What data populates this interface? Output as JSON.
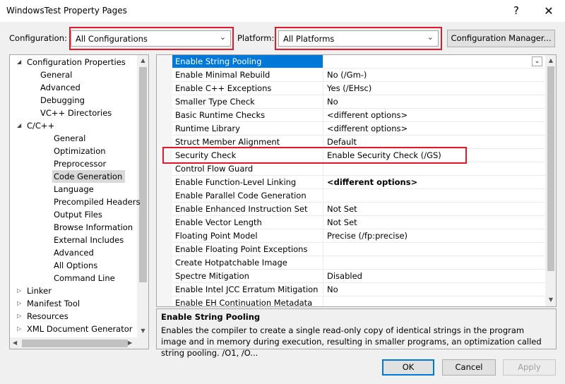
{
  "window": {
    "title": "WindowsTest Property Pages",
    "help_glyph": "?",
    "close_glyph": "✕"
  },
  "toolbar": {
    "configuration_label": "Configuration:",
    "configuration_value": "All Configurations",
    "platform_label": "Platform:",
    "platform_value": "All Platforms",
    "config_manager_label": "Configuration Manager..."
  },
  "tree": {
    "items": [
      {
        "label": "Configuration Properties",
        "expanded": true
      },
      {
        "label": "General"
      },
      {
        "label": "Advanced"
      },
      {
        "label": "Debugging"
      },
      {
        "label": "VC++ Directories"
      },
      {
        "label": "C/C++",
        "expanded": true
      },
      {
        "label": "General"
      },
      {
        "label": "Optimization"
      },
      {
        "label": "Preprocessor"
      },
      {
        "label": "Code Generation",
        "selected": true
      },
      {
        "label": "Language"
      },
      {
        "label": "Precompiled Headers"
      },
      {
        "label": "Output Files"
      },
      {
        "label": "Browse Information"
      },
      {
        "label": "External Includes"
      },
      {
        "label": "Advanced"
      },
      {
        "label": "All Options"
      },
      {
        "label": "Command Line"
      },
      {
        "label": "Linker",
        "expanded": false
      },
      {
        "label": "Manifest Tool",
        "expanded": false
      },
      {
        "label": "Resources",
        "expanded": false
      },
      {
        "label": "XML Document Generator",
        "expanded": false
      }
    ]
  },
  "grid": {
    "rows": [
      {
        "name": "Enable String Pooling",
        "value": "",
        "selected": true
      },
      {
        "name": "Enable Minimal Rebuild",
        "value": "No (/Gm-)"
      },
      {
        "name": "Enable C++ Exceptions",
        "value": "Yes (/EHsc)"
      },
      {
        "name": "Smaller Type Check",
        "value": "No"
      },
      {
        "name": "Basic Runtime Checks",
        "value": "<different options>"
      },
      {
        "name": "Runtime Library",
        "value": "<different options>"
      },
      {
        "name": "Struct Member Alignment",
        "value": "Default"
      },
      {
        "name": "Security Check",
        "value": "Enable Security Check (/GS)",
        "highlighted": true
      },
      {
        "name": "Control Flow Guard",
        "value": ""
      },
      {
        "name": "Enable Function-Level Linking",
        "value": "<different options>",
        "bold": true
      },
      {
        "name": "Enable Parallel Code Generation",
        "value": ""
      },
      {
        "name": "Enable Enhanced Instruction Set",
        "value": "Not Set"
      },
      {
        "name": "Enable Vector Length",
        "value": "Not Set"
      },
      {
        "name": "Floating Point Model",
        "value": "Precise (/fp:precise)"
      },
      {
        "name": "Enable Floating Point Exceptions",
        "value": ""
      },
      {
        "name": "Create Hotpatchable Image",
        "value": ""
      },
      {
        "name": "Spectre Mitigation",
        "value": "Disabled"
      },
      {
        "name": "Enable Intel JCC Erratum Mitigation",
        "value": "No"
      },
      {
        "name": "Enable EH Continuation Metadata",
        "value": ""
      }
    ]
  },
  "description": {
    "title": "Enable String Pooling",
    "text": "Enables the compiler to create a single read-only copy of identical strings in the program image and in memory during execution, resulting in smaller programs, an optimization called string pooling. /O1, /O..."
  },
  "buttons": {
    "ok": "OK",
    "cancel": "Cancel",
    "apply": "Apply"
  },
  "icons": {
    "expanded": "◢",
    "collapsed": "▷",
    "dropdown": "⌄",
    "scroll_up": "▲",
    "scroll_down": "▼",
    "scroll_left": "◀",
    "scroll_right": "▶"
  },
  "colors": {
    "highlight_red": "#e0192b",
    "selection_blue": "#0078d7"
  }
}
